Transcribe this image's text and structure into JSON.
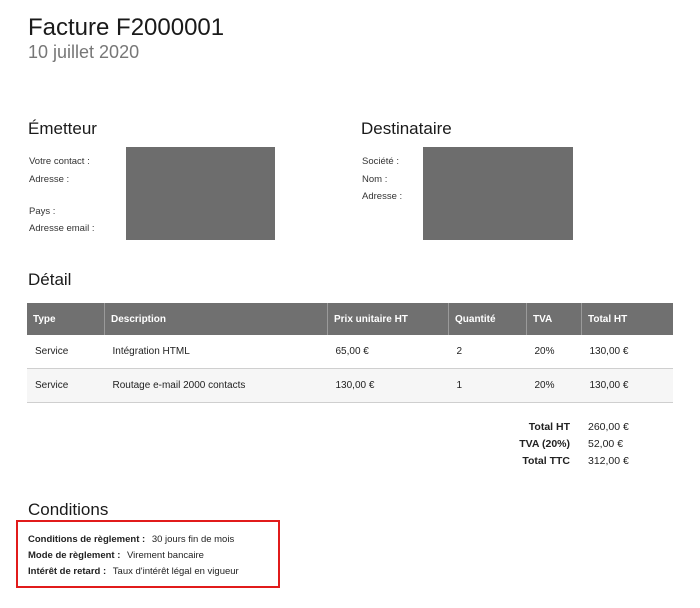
{
  "header": {
    "title": "Facture F2000001",
    "date": "10 juillet 2020"
  },
  "emitter": {
    "title": "Émetteur",
    "labels": [
      "Votre contact :",
      "Adresse :",
      "Pays :",
      "Adresse email :"
    ]
  },
  "recipient": {
    "title": "Destinataire",
    "labels": [
      "Société :",
      "Nom :",
      "Adresse :"
    ]
  },
  "detail": {
    "title": "Détail",
    "columns": [
      "Type",
      "Description",
      "Prix unitaire HT",
      "Quantité",
      "TVA",
      "Total HT"
    ],
    "rows": [
      [
        "Service",
        "Intégration HTML",
        "65,00 €",
        "2",
        "20%",
        "130,00 €"
      ],
      [
        "Service",
        "Routage e-mail 2000 contacts",
        "130,00 €",
        "1",
        "20%",
        "130,00 €"
      ]
    ]
  },
  "totals": [
    {
      "label": "Total HT",
      "value": "260,00 €"
    },
    {
      "label": "TVA (20%)",
      "value": "52,00 €"
    },
    {
      "label": "Total TTC",
      "value": "312,00 €"
    }
  ],
  "conditions": {
    "title": "Conditions",
    "items": [
      {
        "label": "Conditions de règlement :",
        "value": "30 jours fin de mois"
      },
      {
        "label": "Mode de règlement :",
        "value": "Virement bancaire"
      },
      {
        "label": "Intérêt de retard :",
        "value": "Taux d'intérêt légal en vigueur"
      }
    ]
  },
  "colors": {
    "table_header": "#707070",
    "highlight_border": "#e11b1b",
    "redaction": "#6d6d6d"
  }
}
